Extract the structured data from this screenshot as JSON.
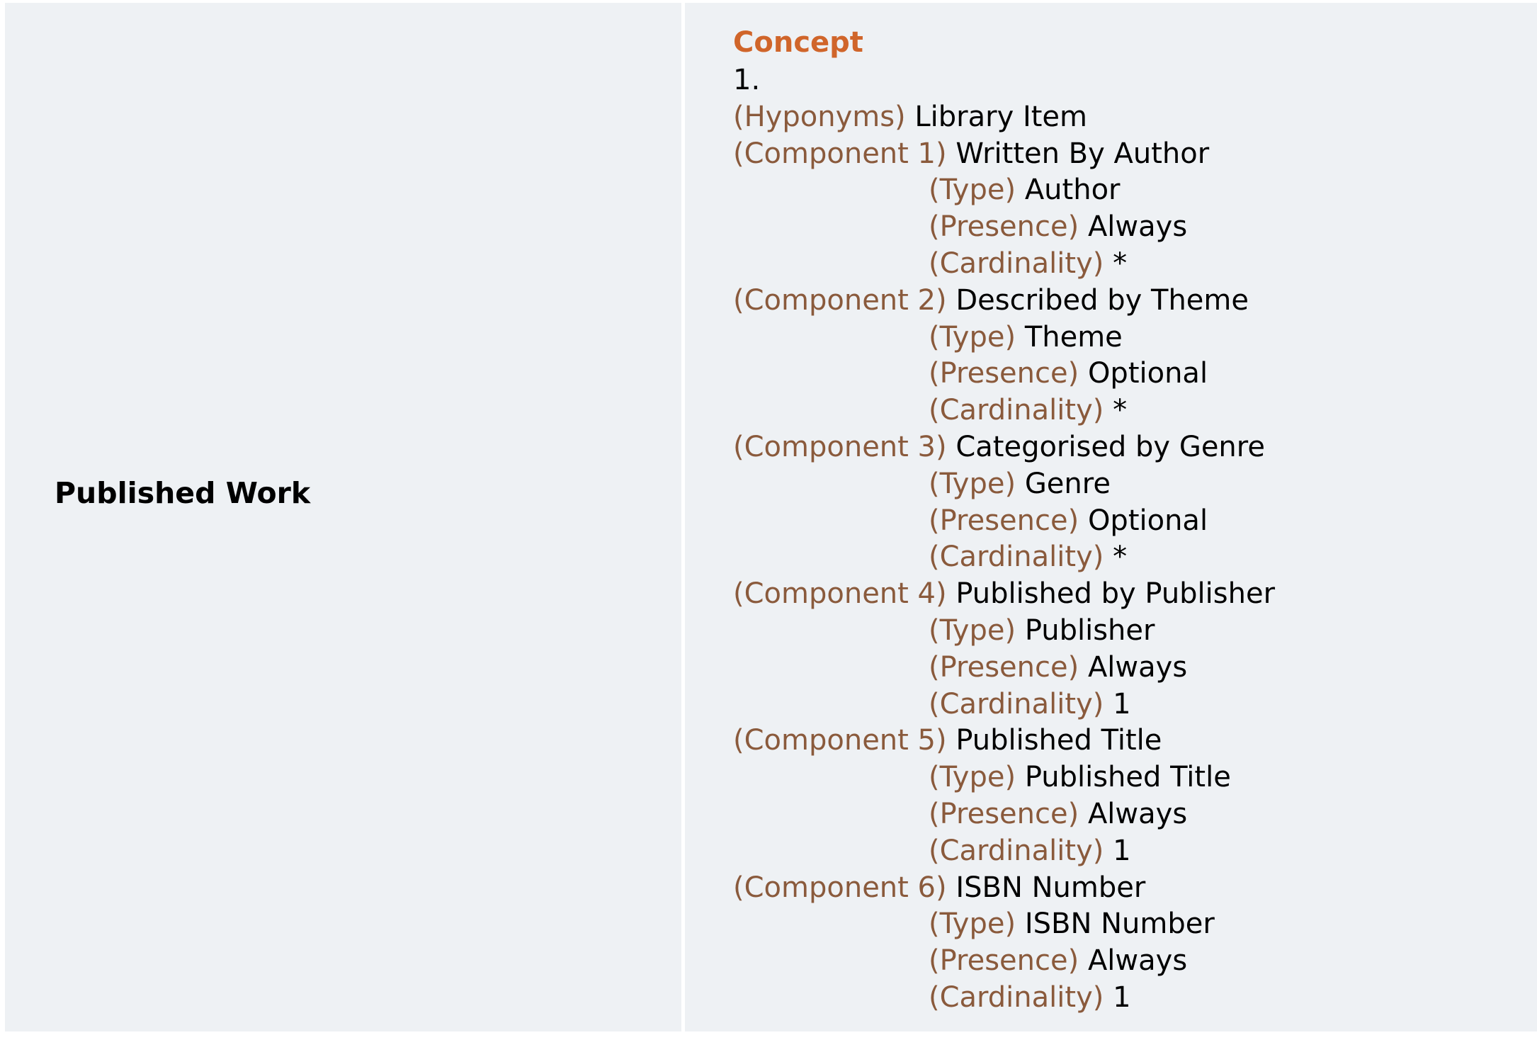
{
  "term": "Published Work",
  "definition": {
    "heading": "Concept",
    "number": "1.",
    "hyponyms": {
      "label": "(Hyponyms)",
      "value": "Library Item"
    },
    "components": [
      {
        "label": "(Component 1)",
        "name": "Written By Author",
        "type_label": "(Type)",
        "type": "Author",
        "presence_label": "(Presence)",
        "presence": "Always",
        "cardinality_label": "(Cardinality)",
        "cardinality": "*"
      },
      {
        "label": "(Component 2)",
        "name": "Described by Theme",
        "type_label": "(Type)",
        "type": "Theme",
        "presence_label": "(Presence)",
        "presence": "Optional",
        "cardinality_label": "(Cardinality)",
        "cardinality": "*"
      },
      {
        "label": "(Component 3)",
        "name": "Categorised by Genre",
        "type_label": "(Type)",
        "type": "Genre",
        "presence_label": "(Presence)",
        "presence": "Optional",
        "cardinality_label": "(Cardinality)",
        "cardinality": "*"
      },
      {
        "label": "(Component 4)",
        "name": "Published by Publisher",
        "type_label": "(Type)",
        "type": "Publisher",
        "presence_label": "(Presence)",
        "presence": "Always",
        "cardinality_label": "(Cardinality)",
        "cardinality": "1"
      },
      {
        "label": "(Component 5)",
        "name": "Published Title",
        "type_label": "(Type)",
        "type": "Published Title",
        "presence_label": "(Presence)",
        "presence": "Always",
        "cardinality_label": "(Cardinality)",
        "cardinality": "1"
      },
      {
        "label": "(Component 6)",
        "name": "ISBN Number",
        "type_label": "(Type)",
        "type": "ISBN Number",
        "presence_label": "(Presence)",
        "presence": "Always",
        "cardinality_label": "(Cardinality)",
        "cardinality": "1"
      }
    ]
  },
  "colors": {
    "heading": "#d0652a",
    "label": "#8a5a3c",
    "cell_background": "#eef1f4",
    "border": "#ffffff"
  }
}
